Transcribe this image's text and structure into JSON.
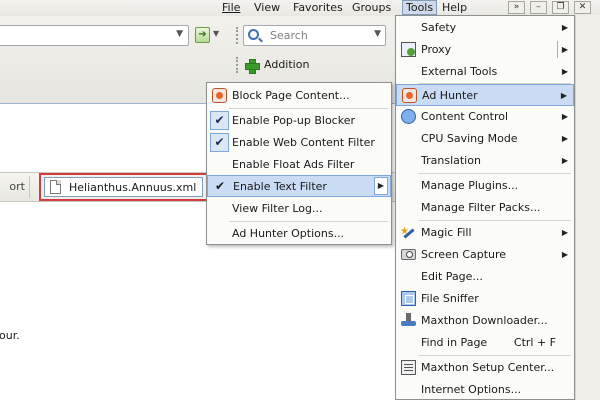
{
  "menubar": {
    "items": [
      {
        "label": "File",
        "mnemonic_index": 0
      },
      {
        "label": "View",
        "mnemonic_index": 0
      },
      {
        "label": "Favorites",
        "mnemonic_index": 1
      },
      {
        "label": "Groups",
        "mnemonic_index": 0
      },
      {
        "label": "Tools",
        "mnemonic_index": 0
      },
      {
        "label": "Help",
        "mnemonic_index": 0
      }
    ],
    "window_buttons": [
      "»",
      "–",
      "❐",
      "✕"
    ]
  },
  "toolbar": {
    "go_icon": "go-arrow",
    "search": {
      "placeholder": "Search"
    },
    "addition_label": "Addition"
  },
  "tabs": {
    "partial_label": "ort",
    "active_title": "Helianthus.Annuus.xml"
  },
  "page": {
    "snippet": "our."
  },
  "ad_hunter_submenu": {
    "items": [
      {
        "label": "Block Page Content...",
        "icon": "block-page-icon",
        "checked": false
      },
      {
        "label": "Enable Pop-up Blocker",
        "checked": true
      },
      {
        "label": "Enable Web Content Filter",
        "checked": true
      },
      {
        "label": "Enable Float Ads Filter",
        "checked": false
      },
      {
        "label": "Enable Text Filter",
        "checked": true,
        "highlighted": true,
        "has_submenu": true
      },
      {
        "label": "View Filter Log...",
        "checked": false
      },
      {
        "label": "Ad Hunter Options...",
        "checked": false
      }
    ]
  },
  "tools_menu": {
    "items": [
      {
        "label": "Safety",
        "has_submenu": true
      },
      {
        "label": "Proxy",
        "icon": "proxy-icon",
        "has_submenu": true
      },
      {
        "label": "External Tools",
        "has_submenu": true
      },
      {
        "label": "Ad Hunter",
        "icon": "ad-hunter-icon",
        "has_submenu": true,
        "highlighted": true
      },
      {
        "label": "Content Control",
        "icon": "content-control-icon",
        "has_submenu": true
      },
      {
        "label": "CPU Saving Mode",
        "has_submenu": true
      },
      {
        "label": "Translation",
        "has_submenu": true
      },
      {
        "label": "Manage Plugins..."
      },
      {
        "label": "Manage Filter Packs..."
      },
      {
        "label": "Magic Fill",
        "icon": "magic-fill-icon",
        "has_submenu": true
      },
      {
        "label": "Screen Capture",
        "icon": "camera-icon",
        "has_submenu": true
      },
      {
        "label": "Edit Page..."
      },
      {
        "label": "File Sniffer",
        "icon": "file-sniffer-icon"
      },
      {
        "label": "Maxthon Downloader...",
        "icon": "downloader-icon"
      },
      {
        "label": "Find in Page",
        "shortcut": "Ctrl + F"
      },
      {
        "label": "Maxthon Setup Center...",
        "icon": "setup-center-icon"
      },
      {
        "label": "Internet Options..."
      }
    ]
  }
}
